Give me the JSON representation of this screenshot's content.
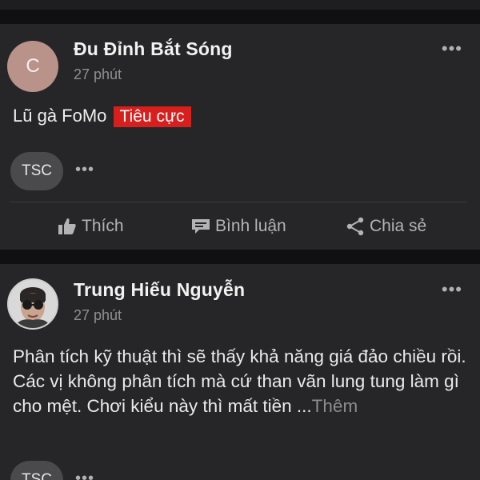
{
  "posts": [
    {
      "avatar_letter": "C",
      "author": "Đu Đỉnh Bắt Sóng",
      "time": "27 phút",
      "text": "Lũ gà FoMo",
      "tag": "Tiêu cực",
      "chip": "TSC",
      "more": "•••"
    },
    {
      "author": "Trung Hiếu Nguyễn",
      "time": "27 phút",
      "text": "Phân tích kỹ thuật thì sẽ thấy khả năng giá đảo chiều rồi. Các vị không phân tích mà cứ than vãn lung tung làm gì cho mệt. Chơi kiểu này thì mất tiền ...",
      "more_link": "Thêm",
      "chip": "TSC",
      "more": "•••"
    }
  ],
  "actions": {
    "like": "Thích",
    "comment": "Bình luận",
    "share": "Chia sẻ"
  },
  "colors": {
    "background": "#18181a",
    "card": "#262628",
    "tag_red": "#d7201e"
  },
  "icons": [
    "like-icon",
    "comment-icon",
    "share-icon",
    "more-options-icon"
  ]
}
